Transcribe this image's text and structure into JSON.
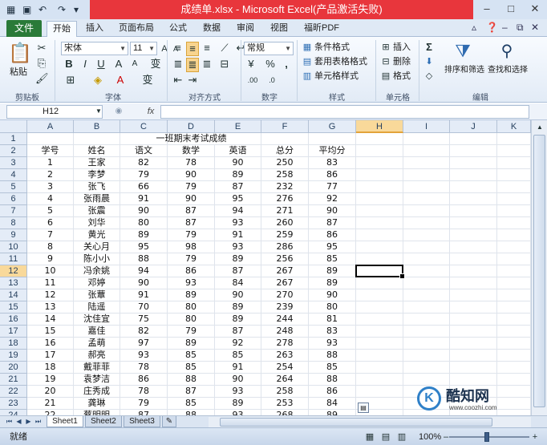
{
  "window": {
    "title": "成绩单.xlsx - Microsoft Excel(产品激活失败)",
    "controls": [
      "–",
      "□",
      "✕"
    ]
  },
  "ribbon_tabs": {
    "file": "文件",
    "tabs": [
      "开始",
      "插入",
      "页面布局",
      "公式",
      "数据",
      "审阅",
      "视图",
      "福昕PDF"
    ],
    "active": "开始"
  },
  "ribbon": {
    "clipboard": {
      "label": "剪贴板",
      "paste": "粘贴"
    },
    "font": {
      "label": "字体",
      "font_name": "宋体",
      "font_size": "11",
      "bold": "B",
      "italic": "I",
      "underline": "U"
    },
    "alignment": {
      "label": "对齐方式"
    },
    "number": {
      "label": "数字",
      "format": "常规",
      "percent": "%",
      "comma": ","
    },
    "styles": {
      "label": "样式",
      "conditional": "条件格式",
      "table": "套用表格格式",
      "cell_styles": "单元格样式"
    },
    "cells": {
      "label": "单元格",
      "insert": "插入",
      "delete": "删除",
      "format": "格式"
    },
    "editing": {
      "label": "编辑",
      "sort": "排序和筛选",
      "find": "查找和选择",
      "sum": "Σ"
    }
  },
  "formula_bar": {
    "name_box": "H12",
    "fx": "fx",
    "value": ""
  },
  "grid": {
    "columns": [
      "A",
      "B",
      "C",
      "D",
      "E",
      "F",
      "G",
      "H",
      "I",
      "J",
      "K"
    ],
    "selected_column": "H",
    "selected_row": "12",
    "active_cell": "H12",
    "title": "一班期末考试成绩",
    "headers": [
      "学号",
      "姓名",
      "语文",
      "数学",
      "英语",
      "总分",
      "平均分"
    ],
    "rows": [
      [
        "1",
        "王家",
        "82",
        "78",
        "90",
        "250",
        "83"
      ],
      [
        "2",
        "李梦",
        "79",
        "90",
        "89",
        "258",
        "86"
      ],
      [
        "3",
        "张飞",
        "66",
        "79",
        "87",
        "232",
        "77"
      ],
      [
        "4",
        "张雨晨",
        "91",
        "90",
        "95",
        "276",
        "92"
      ],
      [
        "5",
        "张震",
        "90",
        "87",
        "94",
        "271",
        "90"
      ],
      [
        "6",
        "刘华",
        "80",
        "87",
        "93",
        "260",
        "87"
      ],
      [
        "7",
        "黄光",
        "89",
        "79",
        "91",
        "259",
        "86"
      ],
      [
        "8",
        "关心月",
        "95",
        "98",
        "93",
        "286",
        "95"
      ],
      [
        "9",
        "陈小小",
        "88",
        "79",
        "89",
        "256",
        "85"
      ],
      [
        "10",
        "冯余姚",
        "94",
        "86",
        "87",
        "267",
        "89"
      ],
      [
        "11",
        "邓婷",
        "90",
        "93",
        "84",
        "267",
        "89"
      ],
      [
        "12",
        "张蕈",
        "91",
        "89",
        "90",
        "270",
        "90"
      ],
      [
        "13",
        "陆遥",
        "70",
        "80",
        "89",
        "239",
        "80"
      ],
      [
        "14",
        "沈佳宜",
        "75",
        "80",
        "89",
        "244",
        "81"
      ],
      [
        "15",
        "嘉佳",
        "82",
        "79",
        "87",
        "248",
        "83"
      ],
      [
        "16",
        "孟萌",
        "97",
        "89",
        "92",
        "278",
        "93"
      ],
      [
        "17",
        "郝亮",
        "93",
        "85",
        "85",
        "263",
        "88"
      ],
      [
        "18",
        "戴菲菲",
        "78",
        "85",
        "91",
        "254",
        "85"
      ],
      [
        "19",
        "袁梦洁",
        "86",
        "88",
        "90",
        "264",
        "88"
      ],
      [
        "20",
        "庄秀成",
        "78",
        "87",
        "93",
        "258",
        "86"
      ],
      [
        "21",
        "龚琳",
        "79",
        "85",
        "89",
        "253",
        "84"
      ],
      [
        "22",
        "蔡明明",
        "87",
        "88",
        "93",
        "268",
        "89"
      ]
    ]
  },
  "sheets": {
    "tabs": [
      "Sheet1",
      "Sheet2",
      "Sheet3"
    ],
    "active": "Sheet1"
  },
  "status": {
    "text": "就绪",
    "zoom": "100%"
  },
  "watermark": {
    "name": "酷知网",
    "url": "www.coozhi.com"
  }
}
